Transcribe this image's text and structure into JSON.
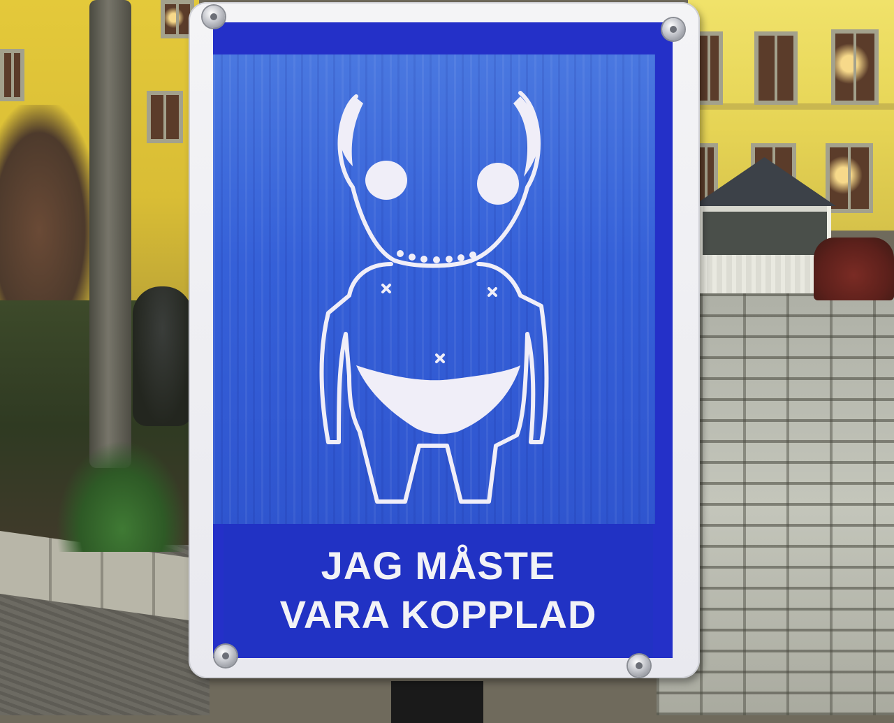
{
  "sign": {
    "caption_line_1": "JAG MÅSTE",
    "caption_line_2": "VARA KOPPLAD"
  },
  "colors": {
    "sign_blue": "#2430c8",
    "sign_border": "#f4f4f6",
    "building_yellow": "#e6d455"
  }
}
